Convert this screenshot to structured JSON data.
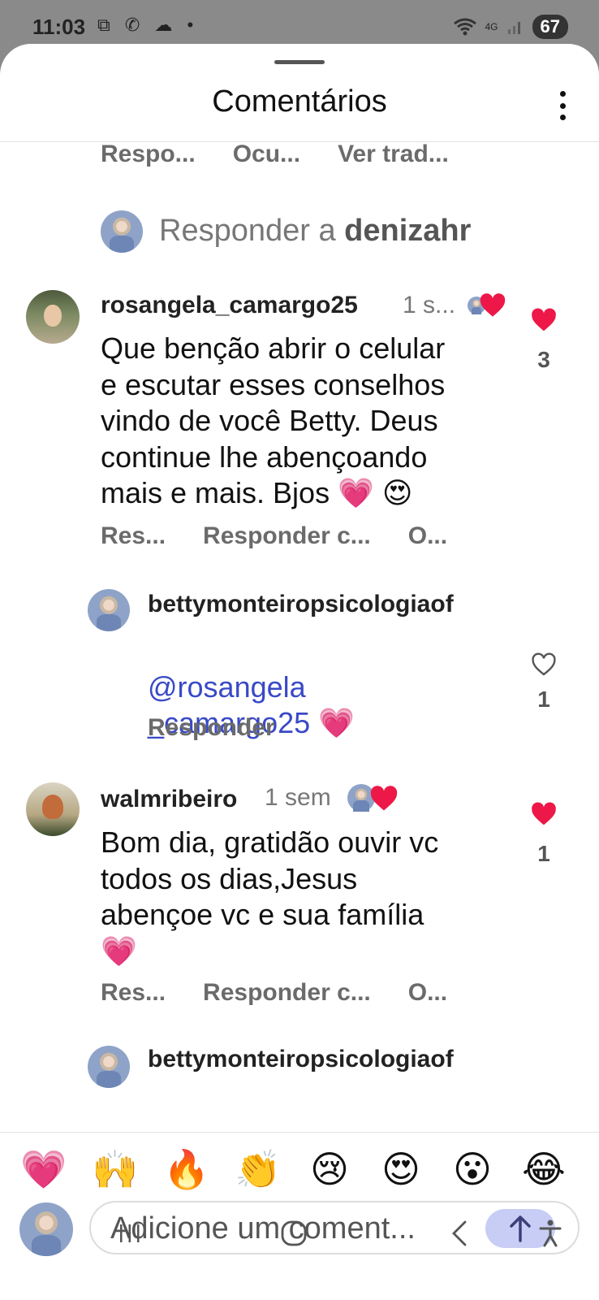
{
  "status": {
    "time": "11:03",
    "left_icons": "⧉ ✆ ☁ •",
    "network": "4G",
    "battery": "67"
  },
  "sheet": {
    "title": "Comentários"
  },
  "top_actions": [
    "Respo...",
    "Ocu...",
    "Ver trad..."
  ],
  "reply_prompt": {
    "prefix": "Responder a ",
    "user": "denizahr"
  },
  "comments": [
    {
      "username": "rosangela_camargo25",
      "time": "1 s...",
      "text": "Que  benção abrir o celular\ne escutar esses conselhos\nvindo de você Betty. Deus\ncontinue lhe abençoando\nmais e  mais. Bjos 💗 😍",
      "likes": "3",
      "actions": [
        "Res...",
        "Responder c...",
        "O..."
      ]
    },
    {
      "username": "bettymonteiropsicologiaof",
      "mention_line1": "@rosangela",
      "mention_line2": "_camargo25",
      "emoji": "💗",
      "likes": "1",
      "reply": "Responder"
    },
    {
      "username": "walmribeiro",
      "time": "1 sem",
      "text": "Bom dia, gratidão ouvir vc\ntodos os dias,Jesus\nabençoe vc e sua família\n💗",
      "likes": "1",
      "actions": [
        "Res...",
        "Responder c...",
        "O..."
      ]
    },
    {
      "username": "bettymonteiropsicologiaof"
    }
  ],
  "emoji_bar": [
    "💗",
    "🙌",
    "🔥",
    "👏",
    "😢",
    "😍",
    "😮",
    "😂"
  ],
  "composer": {
    "placeholder": "Adicione um coment..."
  },
  "colors": {
    "heart": "#ed1848",
    "mention": "#3949c7",
    "send_bg": "#c8cdf5"
  }
}
